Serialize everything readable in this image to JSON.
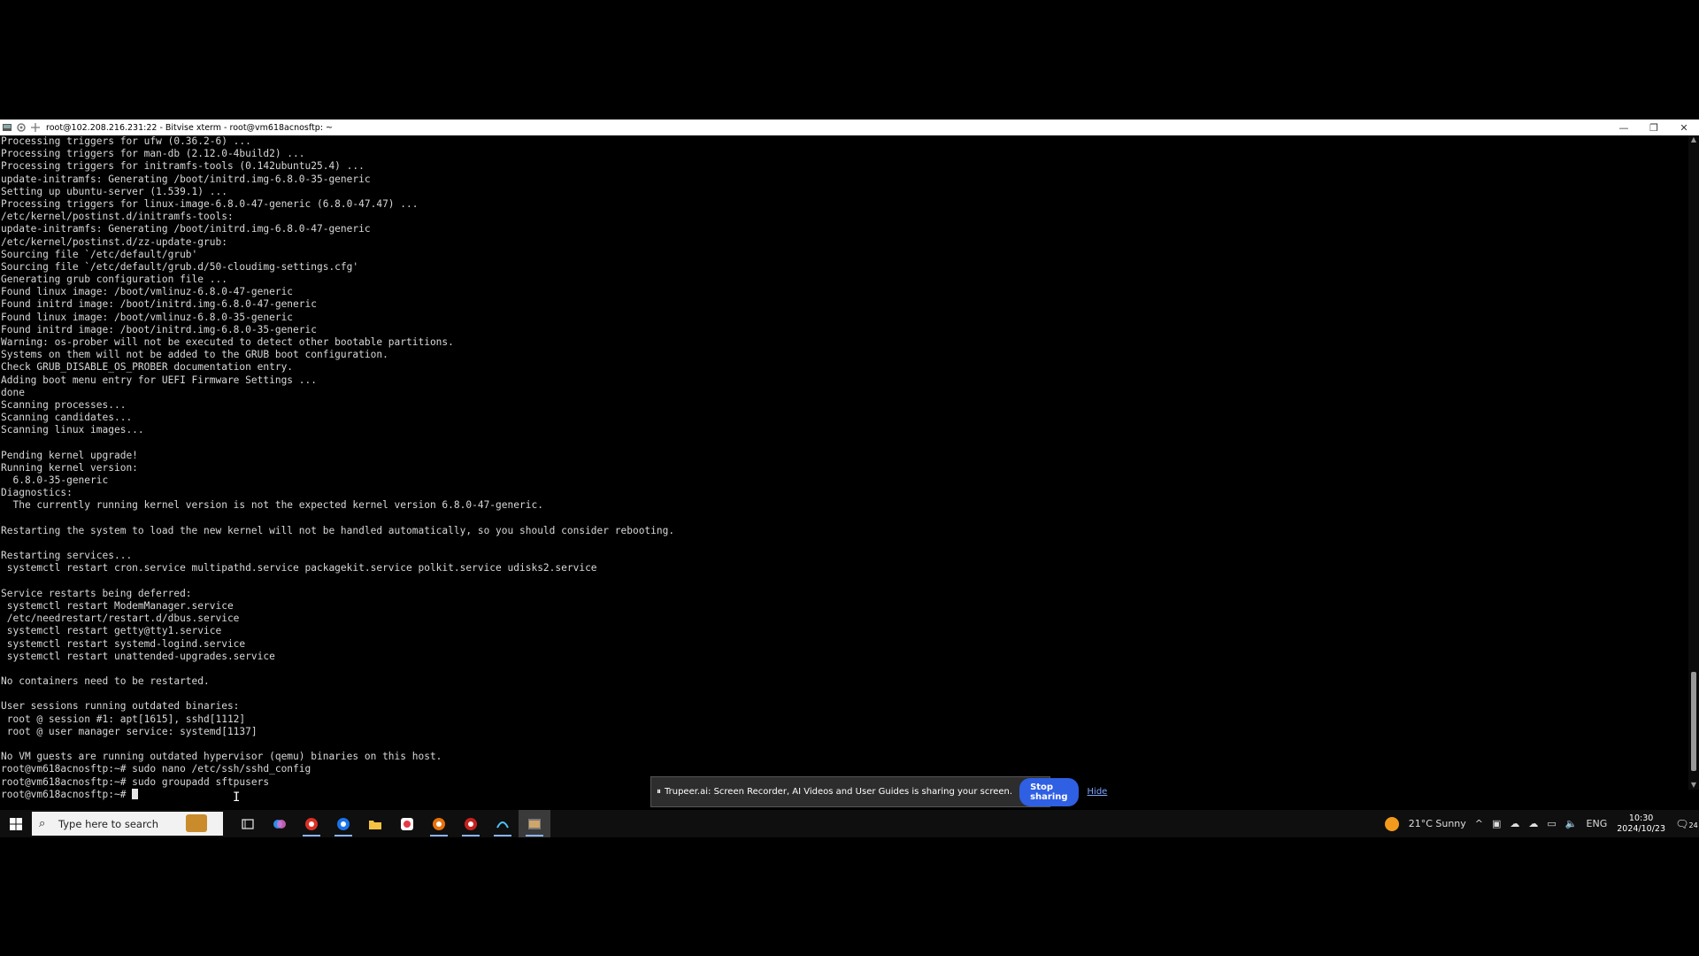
{
  "window": {
    "title": "root@102.208.216.231:22 - Bitvise xterm - root@vm618acnosftp: ~",
    "controls": {
      "minimize": "—",
      "restore": "❐",
      "close": "✕"
    }
  },
  "terminal": {
    "lines": [
      "Processing triggers for ufw (0.36.2-6) ...",
      "Processing triggers for man-db (2.12.0-4build2) ...",
      "Processing triggers for initramfs-tools (0.142ubuntu25.4) ...",
      "update-initramfs: Generating /boot/initrd.img-6.8.0-35-generic",
      "Setting up ubuntu-server (1.539.1) ...",
      "Processing triggers for linux-image-6.8.0-47-generic (6.8.0-47.47) ...",
      "/etc/kernel/postinst.d/initramfs-tools:",
      "update-initramfs: Generating /boot/initrd.img-6.8.0-47-generic",
      "/etc/kernel/postinst.d/zz-update-grub:",
      "Sourcing file `/etc/default/grub'",
      "Sourcing file `/etc/default/grub.d/50-cloudimg-settings.cfg'",
      "Generating grub configuration file ...",
      "Found linux image: /boot/vmlinuz-6.8.0-47-generic",
      "Found initrd image: /boot/initrd.img-6.8.0-47-generic",
      "Found linux image: /boot/vmlinuz-6.8.0-35-generic",
      "Found initrd image: /boot/initrd.img-6.8.0-35-generic",
      "Warning: os-prober will not be executed to detect other bootable partitions.",
      "Systems on them will not be added to the GRUB boot configuration.",
      "Check GRUB_DISABLE_OS_PROBER documentation entry.",
      "Adding boot menu entry for UEFI Firmware Settings ...",
      "done",
      "Scanning processes...",
      "Scanning candidates...",
      "Scanning linux images...",
      "",
      "Pending kernel upgrade!",
      "Running kernel version:",
      "  6.8.0-35-generic",
      "Diagnostics:",
      "  The currently running kernel version is not the expected kernel version 6.8.0-47-generic.",
      "",
      "Restarting the system to load the new kernel will not be handled automatically, so you should consider rebooting.",
      "",
      "Restarting services...",
      " systemctl restart cron.service multipathd.service packagekit.service polkit.service udisks2.service",
      "",
      "Service restarts being deferred:",
      " systemctl restart ModemManager.service",
      " /etc/needrestart/restart.d/dbus.service",
      " systemctl restart getty@tty1.service",
      " systemctl restart systemd-logind.service",
      " systemctl restart unattended-upgrades.service",
      "",
      "No containers need to be restarted.",
      "",
      "User sessions running outdated binaries:",
      " root @ session #1: apt[1615], sshd[1112]",
      " root @ user manager service: systemd[1137]",
      "",
      "No VM guests are running outdated hypervisor (qemu) binaries on this host.",
      "root@vm618acnosftp:~# sudo nano /etc/ssh/sshd_config",
      "root@vm618acnosftp:~# sudo groupadd sftpusers"
    ],
    "prompt": "root@vm618acnosftp:~# "
  },
  "share_banner": {
    "text": "Trupeer.ai: Screen Recorder, AI Videos and User Guides is sharing your screen.",
    "stop_label": "Stop sharing",
    "hide_label": "Hide"
  },
  "taskbar": {
    "search_placeholder": "Type here to search",
    "apps": [
      "task-view-icon",
      "copilot-icon",
      "chrome-icon",
      "chrome-icon",
      "file-explorer-icon",
      "app-icon",
      "chrome-icon",
      "chrome-icon",
      "bitvise-icon",
      "terminal-icon"
    ],
    "weather": "21°C  Sunny",
    "language": "ENG",
    "time": "10:30",
    "date": "2024/10/23",
    "notifications": "24"
  },
  "colors": {
    "terminal_bg": "#000000",
    "terminal_fg": "#d8d8d8",
    "stop_button": "#2f5fe3"
  }
}
